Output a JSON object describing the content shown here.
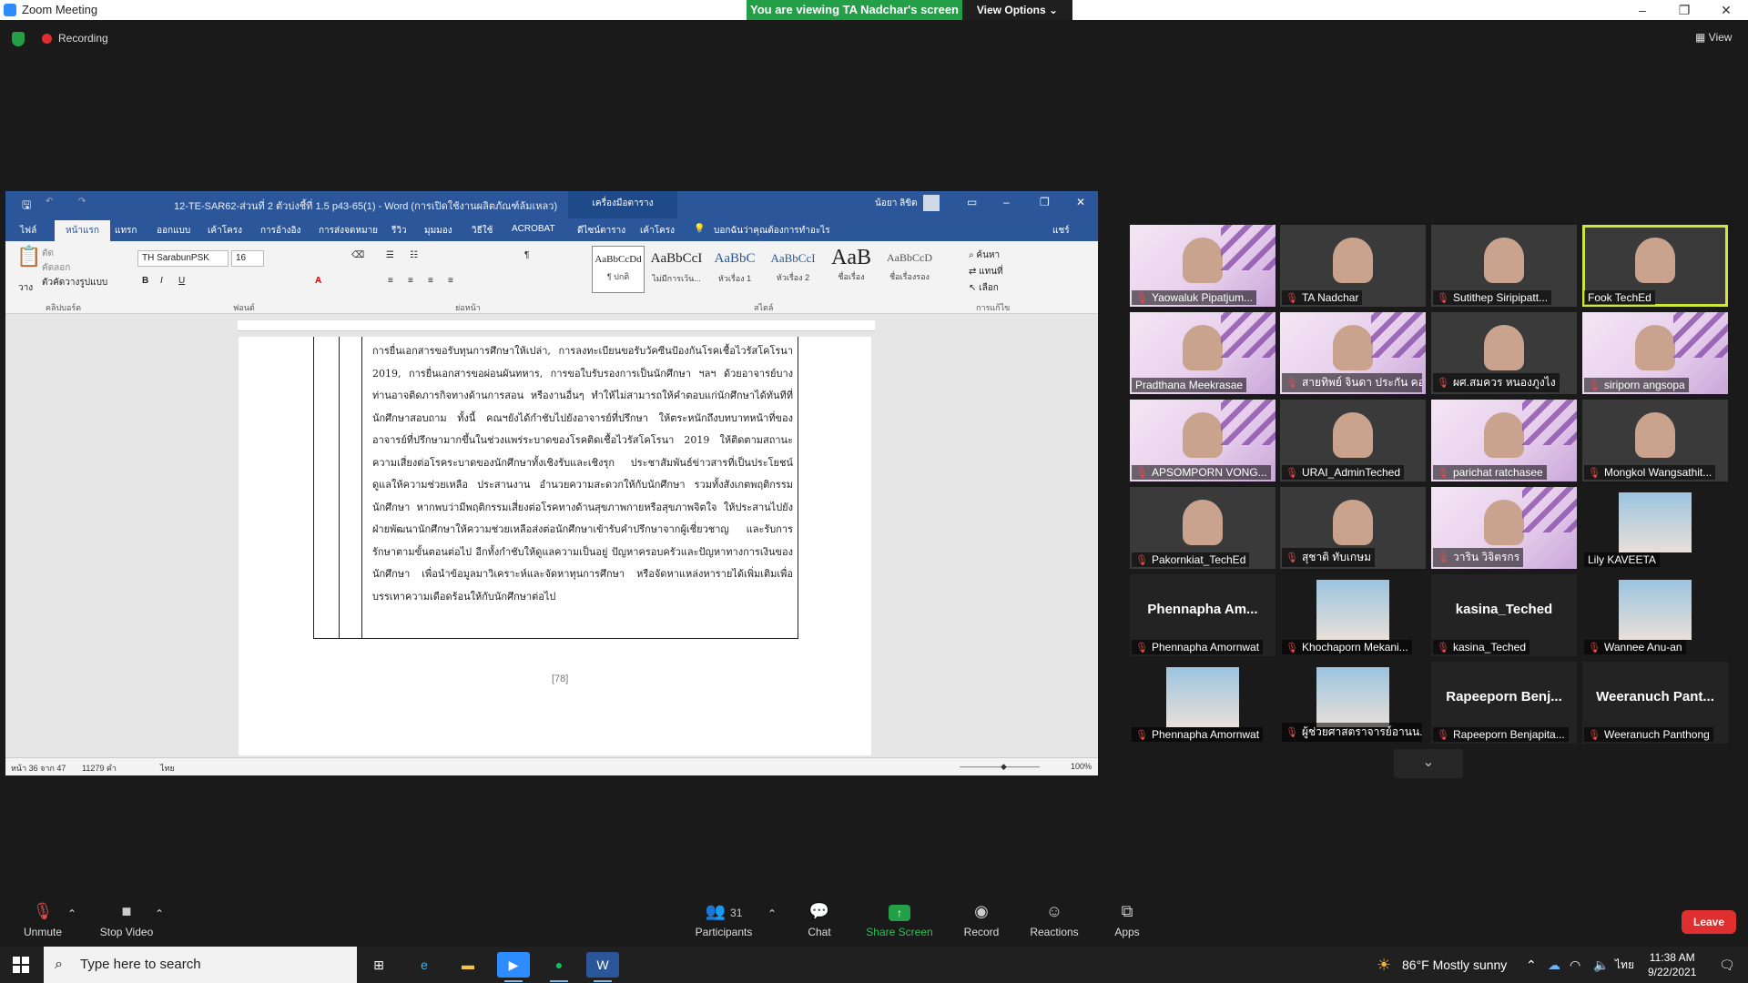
{
  "window": {
    "app_title": "Zoom Meeting",
    "viewing_banner": "You are viewing TA Nadchar's screen",
    "view_options": "View Options",
    "win_minimize": "–",
    "win_restore": "❐",
    "win_close": "✕"
  },
  "meeting": {
    "recording_label": "Recording",
    "view_label": "View"
  },
  "word": {
    "title": "12-TE-SAR62-ส่วนที่ 2 ตัวบ่งชี้ที่ 1.5 p43-65(1) - Word (การเปิดใช้งานผลิตภัณฑ์ล้มเหลว)",
    "table_tools": "เครื่องมือตาราง",
    "user": "น้อยา ลิขิต",
    "tabs": [
      "ไฟล์",
      "หน้าแรก",
      "แทรก",
      "ออกแบบ",
      "เค้าโครง",
      "การอ้างอิง",
      "การส่งจดหมาย",
      "รีวิว",
      "มุมมอง",
      "วิธีใช้",
      "ACROBAT",
      "ดีไซน์ตาราง",
      "เค้าโครง",
      "บอกฉันว่าคุณต้องการทำอะไร",
      "แชร์"
    ],
    "font_name": "TH SarabunPSK",
    "font_size": "16",
    "styles": [
      {
        "sample": "AaBbCcDd",
        "name": "¶ ปกติ"
      },
      {
        "sample": "AaBbCcI",
        "name": "ไม่มีการเว้น..."
      },
      {
        "sample": "AaBbC",
        "name": "หัวเรื่อง 1"
      },
      {
        "sample": "AaBbCcI",
        "name": "หัวเรื่อง 2"
      },
      {
        "sample": "AaB",
        "name": "ชื่อเรื่อง"
      },
      {
        "sample": "AaBbCcD",
        "name": "ชื่อเรื่องรอง"
      }
    ],
    "group_labels": [
      "คลิปบอร์ด",
      "ฟอนต์",
      "ย่อหน้า",
      "สไตล์",
      "การแก้ไข"
    ],
    "editing": [
      "ค้นหา",
      "แทนที่",
      "เลือก"
    ],
    "clipboard": [
      "วาง",
      "ตัด",
      "คัดลอก",
      "ตัวคัดวางรูปแบบ"
    ],
    "document_text": "การยื่นเอกสารขอรับทุนการศึกษาให้เปล่า, การลงทะเบียนขอรับวัคซีนป้องกันโรคเชื้อไวรัสโคโรนา 2019, การยื่นเอกสารขอผ่อนผันทหาร, การขอใบรับรองการเป็นนักศึกษา ฯลฯ ด้วยอาจารย์บางท่านอาจติดภารกิจทางด้านการสอน หรืองานอื่นๆ ทำให้ไม่สามารถให้คำตอบแก่นักศึกษาได้ทันทีที่นักศึกษาสอบถาม ทั้งนี้ คณฯยังได้กำชับไปยังอาจารย์ที่ปรึกษา ให้ตระหนักถึงบทบาทหน้าที่ของอาจารย์ที่ปรึกษามากขึ้นในช่วงแพร่ระบาดของโรคติดเชื้อไวรัสโคโรนา 2019 ให้ติดตามสถานะความเสี่ยงต่อโรคระบาดของนักศึกษาทั้งเชิงรับและเชิงรุก ประชาสัมพันธ์ข่าวสารที่เป็นประโยชน์ ดูแลให้ความช่วยเหลือ ประสานงาน อำนวยความสะดวกให้กับนักศึกษา รวมทั้งสังเกตพฤติกรรมนักศึกษา หากพบว่ามีพฤติกรรมเสี่ยงต่อโรคทางด้านสุขภาพกายหรือสุขภาพจิตใจ ให้ประสานไปยังฝ่ายพัฒนานักศึกษาให้ความช่วยเหลือส่งต่อนักศึกษาเข้ารับคำปรึกษาจากผู้เชี่ยวชาญ และรับการรักษาตามขั้นตอนต่อไป อีกทั้งกำชับให้ดูแลความเป็นอยู่ ปัญหาครอบครัวและปัญหาทางการเงินของนักศึกษา เพื่อนำข้อมูลมาวิเคราะห์และจัดหาทุนการศึกษา หรือจัดหาแหล่งหารายได้เพิ่มเติมเพื่อบรรเทาความเดือดร้อนให้กับนักศึกษาต่อไป",
    "page_number": "[78]",
    "status_page": "หน้า 36 จาก 47",
    "status_words": "11279 คำ",
    "status_lang": "ไทย",
    "zoom": "100%"
  },
  "participants": [
    {
      "name": "Yaowaluk Pipatjum...",
      "kind": "slide",
      "muted": true
    },
    {
      "name": "TA Nadchar",
      "kind": "cam",
      "muted": true
    },
    {
      "name": "Sutithep Siripipatt...",
      "kind": "cam",
      "muted": true
    },
    {
      "name": "Fook TechEd",
      "kind": "cam",
      "muted": false,
      "active": true
    },
    {
      "name": "Pradthana Meekrasae",
      "kind": "slide",
      "muted": false
    },
    {
      "name": "สายทิพย์ จินดา ประกัน คอ...",
      "kind": "slide",
      "muted": true
    },
    {
      "name": "ผศ.สมควร หนองภูงไง",
      "kind": "cam",
      "muted": true
    },
    {
      "name": "siriporn angsopa",
      "kind": "slide",
      "muted": true
    },
    {
      "name": "APSOMPORN VONG...",
      "kind": "slide",
      "muted": true
    },
    {
      "name": "URAI_AdminTeched",
      "kind": "cam",
      "muted": true
    },
    {
      "name": "parichat ratchasee",
      "kind": "slide",
      "muted": true
    },
    {
      "name": "Mongkol Wangsathit...",
      "kind": "cam",
      "muted": true
    },
    {
      "name": "Pakornkiat_TechEd",
      "kind": "cam",
      "muted": true
    },
    {
      "name": "สุชาติ ทับเกษม",
      "kind": "cam",
      "muted": true
    },
    {
      "name": "วาริน วิจิตรกร",
      "kind": "slide",
      "muted": true
    },
    {
      "name": "Lily KAVEETA",
      "kind": "photo",
      "muted": false
    },
    {
      "name": "Phennapha Amornwat",
      "kind": "name",
      "big": "Phennapha  Am...",
      "muted": true
    },
    {
      "name": "Khochaporn Mekani...",
      "kind": "photo",
      "muted": true
    },
    {
      "name": "kasina_Teched",
      "kind": "name",
      "big": "kasina_Teched",
      "muted": true
    },
    {
      "name": "Wannee Anu-an",
      "kind": "photo",
      "muted": true
    },
    {
      "name": "Phennapha Amornwat",
      "kind": "photo",
      "muted": true
    },
    {
      "name": "ผู้ช่วยศาสตราจารย์อานน...",
      "kind": "photo",
      "muted": true
    },
    {
      "name": "Rapeeporn Benjapita...",
      "kind": "name",
      "big": "Rapeeporn  Benj...",
      "muted": true
    },
    {
      "name": "Weeranuch Panthong",
      "kind": "name",
      "big": "Weeranuch  Pant...",
      "muted": true
    }
  ],
  "toolbar": {
    "unmute": "Unmute",
    "stop_video": "Stop Video",
    "participants": "Participants",
    "participant_count": "31",
    "chat": "Chat",
    "share_screen": "Share Screen",
    "record": "Record",
    "reactions": "Reactions",
    "apps": "Apps",
    "leave": "Leave"
  },
  "taskbar": {
    "search_placeholder": "Type here to search",
    "weather": "86°F  Mostly sunny",
    "lang": "ไทย",
    "time": "11:38 AM",
    "date": "9/22/2021",
    "notifications": "1"
  },
  "colors": {
    "zoom_green": "#23a047",
    "word_blue": "#2b579a",
    "leave_red": "#e02f2f",
    "active_speaker": "#cfe73a"
  }
}
